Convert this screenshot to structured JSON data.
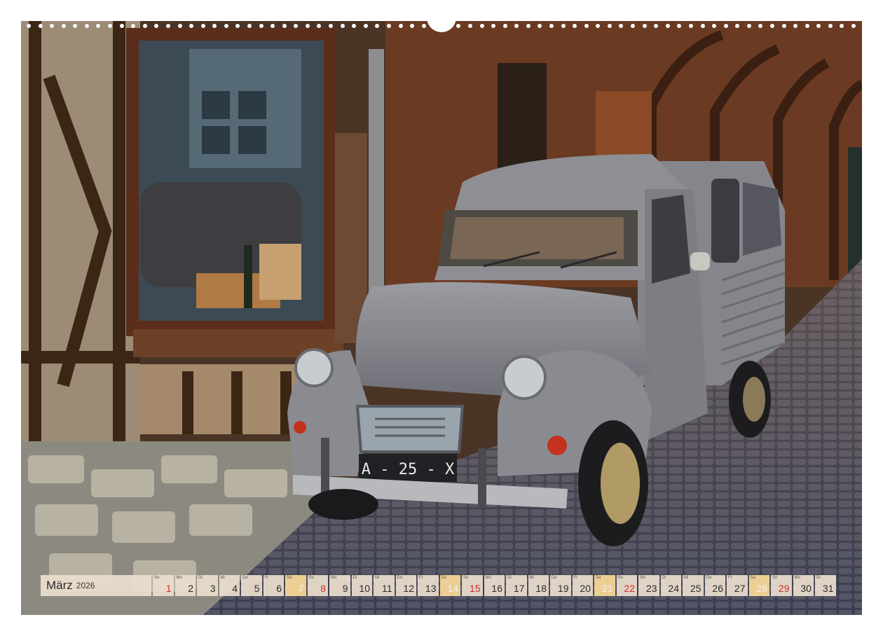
{
  "calendar": {
    "month": "März",
    "year": "2026",
    "days": [
      {
        "wd": "So",
        "d": "1",
        "type": "sun"
      },
      {
        "wd": "Mo",
        "d": "2",
        "type": "wk"
      },
      {
        "wd": "Di",
        "d": "3",
        "type": "wk"
      },
      {
        "wd": "Mi",
        "d": "4",
        "type": "wk"
      },
      {
        "wd": "Do",
        "d": "5",
        "type": "wk"
      },
      {
        "wd": "Fr",
        "d": "6",
        "type": "wk"
      },
      {
        "wd": "Sa",
        "d": "7",
        "type": "sat"
      },
      {
        "wd": "So",
        "d": "8",
        "type": "sun"
      },
      {
        "wd": "Mo",
        "d": "9",
        "type": "wk"
      },
      {
        "wd": "Di",
        "d": "10",
        "type": "wk"
      },
      {
        "wd": "Mi",
        "d": "11",
        "type": "wk"
      },
      {
        "wd": "Do",
        "d": "12",
        "type": "wk"
      },
      {
        "wd": "Fr",
        "d": "13",
        "type": "wk"
      },
      {
        "wd": "Sa",
        "d": "14",
        "type": "sat"
      },
      {
        "wd": "So",
        "d": "15",
        "type": "sun"
      },
      {
        "wd": "Mo",
        "d": "16",
        "type": "wk"
      },
      {
        "wd": "Di",
        "d": "17",
        "type": "wk"
      },
      {
        "wd": "Mi",
        "d": "18",
        "type": "wk"
      },
      {
        "wd": "Do",
        "d": "19",
        "type": "wk"
      },
      {
        "wd": "Fr",
        "d": "20",
        "type": "wk"
      },
      {
        "wd": "Sa",
        "d": "21",
        "type": "sat"
      },
      {
        "wd": "So",
        "d": "22",
        "type": "sun"
      },
      {
        "wd": "Mo",
        "d": "23",
        "type": "wk"
      },
      {
        "wd": "Di",
        "d": "24",
        "type": "wk"
      },
      {
        "wd": "Mi",
        "d": "25",
        "type": "wk"
      },
      {
        "wd": "Do",
        "d": "26",
        "type": "wk"
      },
      {
        "wd": "Fr",
        "d": "27",
        "type": "wk"
      },
      {
        "wd": "Sa",
        "d": "28",
        "type": "sat"
      },
      {
        "wd": "So",
        "d": "29",
        "type": "sun"
      },
      {
        "wd": "Mo",
        "d": "30",
        "type": "wk"
      },
      {
        "wd": "Di",
        "d": "31",
        "type": "wk"
      }
    ]
  },
  "photo": {
    "plate_text": "A - 25 - X"
  },
  "colors": {
    "sunday": "#d12b2b",
    "saturday_cell": "#f6d696",
    "cell": "#ebdece"
  }
}
